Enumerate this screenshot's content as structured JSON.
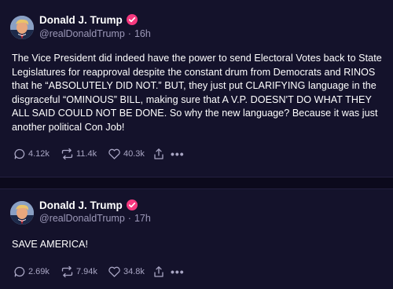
{
  "colors": {
    "background": "#14122b",
    "separator": "#0c0a1c",
    "verified_badge": "#f5387e",
    "muted_text": "#9c98b8"
  },
  "posts": [
    {
      "display_name": "Donald J. Trump",
      "handle": "@realDonaldTrump",
      "dot": "·",
      "time": "16h",
      "verified_icon": "verified-badge-icon",
      "body": "The Vice President did indeed have the power to send Electoral Votes back to State Legislatures for reapproval despite the constant drum from Democrats and RINOS that he “ABSOLUTELY DID NOT.” BUT, they just put CLARIFYING language in the disgraceful “OMINOUS” BILL, making sure that A V.P. DOESN'T DO WHAT THEY ALL SAID COULD NOT BE DONE. So why the new language? Because it was just another political Con Job!",
      "replies": "4.12k",
      "reposts": "11.4k",
      "likes": "40.3k",
      "more": "•••"
    },
    {
      "display_name": "Donald J. Trump",
      "handle": "@realDonaldTrump",
      "dot": "·",
      "time": "17h",
      "verified_icon": "verified-badge-icon",
      "body": "SAVE AMERICA!",
      "replies": "2.69k",
      "reposts": "7.94k",
      "likes": "34.8k",
      "more": "•••"
    }
  ]
}
